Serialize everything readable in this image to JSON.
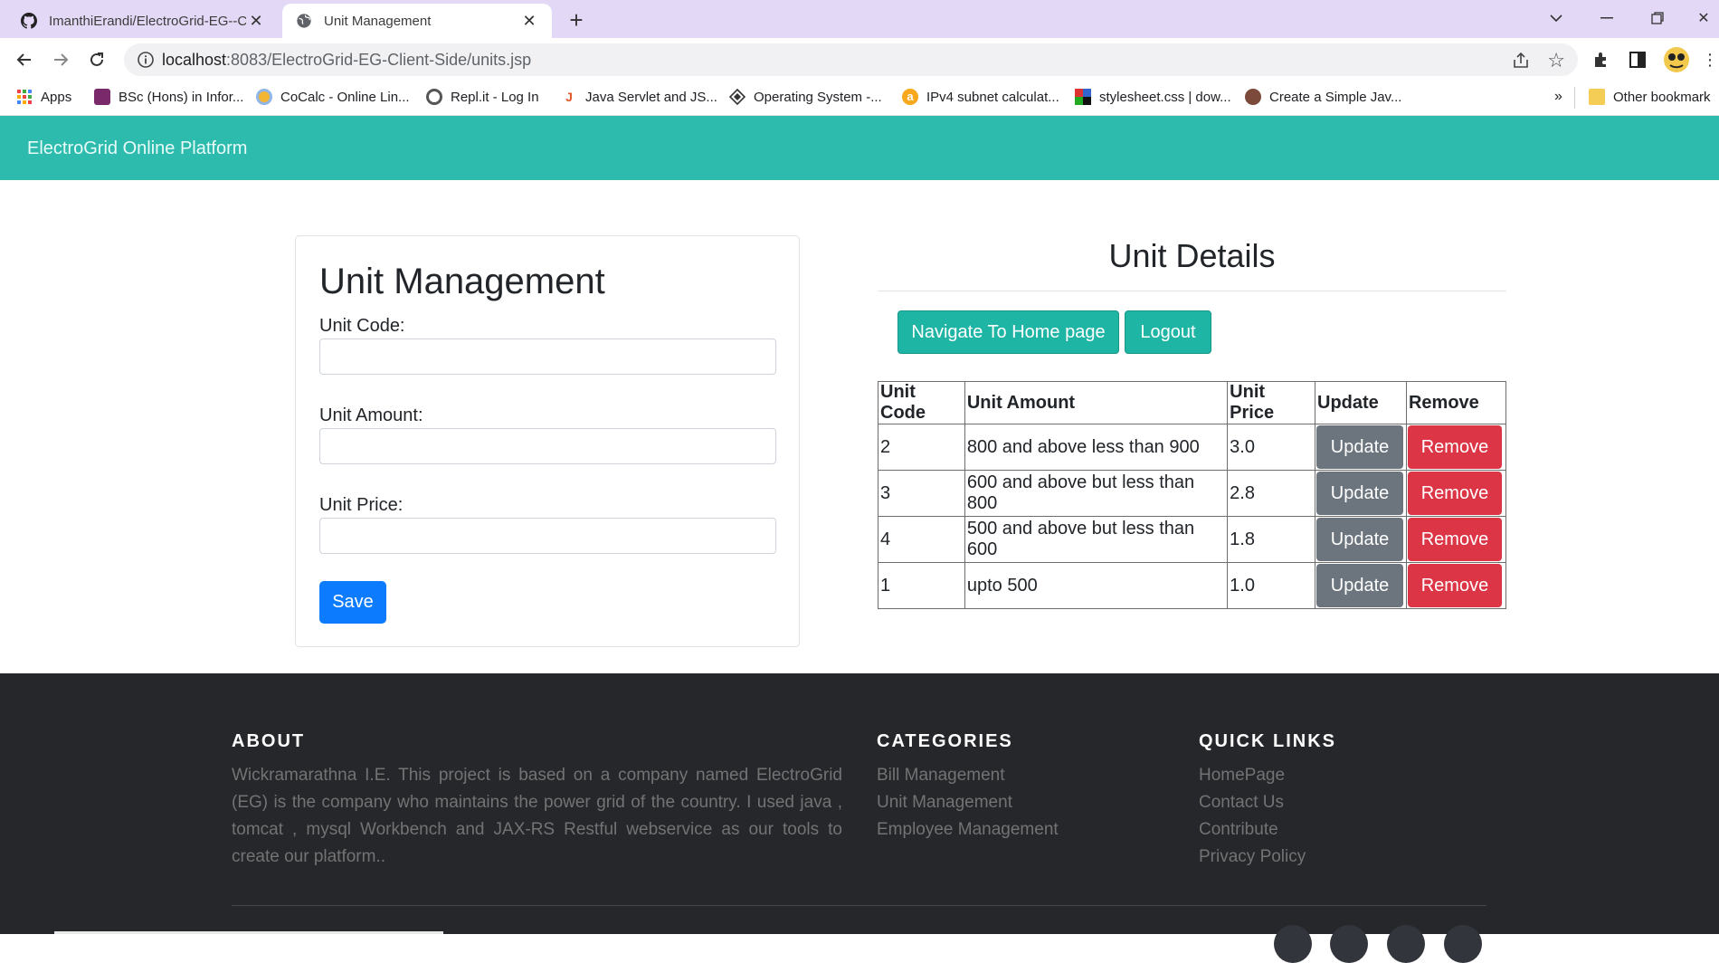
{
  "browser": {
    "tabs": [
      {
        "title": "ImanthiErandi/ElectroGrid-EG--Cl",
        "active": false
      },
      {
        "title": "Unit Management",
        "active": true
      }
    ],
    "address": {
      "host": "localhost",
      "path": ":8083/ElectroGrid-EG-Client-Side/units.jsp"
    },
    "bookmarks": [
      {
        "label": "Apps"
      },
      {
        "label": "BSc (Hons) in Infor..."
      },
      {
        "label": "CoCalc - Online Lin..."
      },
      {
        "label": "Repl.it - Log In"
      },
      {
        "label": "Java Servlet and JS..."
      },
      {
        "label": "Operating System -..."
      },
      {
        "label": "IPv4 subnet calculat..."
      },
      {
        "label": "stylesheet.css | dow..."
      },
      {
        "label": "Create a Simple Jav..."
      }
    ],
    "overflow": "»",
    "other_bookmarks": "Other bookmark"
  },
  "navbar": {
    "brand": "ElectroGrid Online Platform"
  },
  "form": {
    "title": "Unit Management",
    "unit_code_label": "Unit Code:",
    "unit_amount_label": "Unit Amount:",
    "unit_price_label": "Unit Price:",
    "save_label": "Save"
  },
  "details": {
    "title": "Unit Details",
    "home_button": "Navigate To Home page",
    "logout_button": "Logout",
    "columns": [
      "Unit Code",
      "Unit Amount",
      "Unit Price",
      "Update",
      "Remove"
    ],
    "rows": [
      {
        "code": "2",
        "amount": "800 and above less than 900",
        "price": "3.0",
        "update": "Update",
        "remove": "Remove"
      },
      {
        "code": "3",
        "amount": "600 and above but less than 800",
        "price": "2.8",
        "update": "Update",
        "remove": "Remove"
      },
      {
        "code": "4",
        "amount": "500 and above but less than 600",
        "price": "1.8",
        "update": "Update",
        "remove": "Remove"
      },
      {
        "code": "1",
        "amount": "upto 500",
        "price": "1.0",
        "update": "Update",
        "remove": "Remove"
      }
    ]
  },
  "footer": {
    "about_heading": "ABOUT",
    "about_text": "Wickramarathna I.E. This project is based on a company named ElectroGrid (EG) is the company who maintains the power grid of the country. I used java , tomcat , mysql Workbench and JAX-RS Restful webservice as our tools to create our platform..",
    "categories_heading": "CATEGORIES",
    "categories": [
      "Bill Management",
      "Unit Management",
      "Employee Management"
    ],
    "quick_links_heading": "QUICK LINKS",
    "quick_links": [
      "HomePage",
      "Contact Us",
      "Contribute",
      "Privacy Policy"
    ]
  },
  "colors": {
    "navbar": "#2cbbad",
    "teal_button": "#1fb5a5",
    "save_button": "#0d7bfd",
    "update_button": "#6c757d",
    "remove_button": "#dc3545",
    "footer": "#26272b",
    "tabbar": "#e3d9f6"
  },
  "icons": {
    "github_tab": "github-icon",
    "globe_tab": "globe-icon",
    "back": "back-arrow-icon",
    "forward": "forward-arrow-icon",
    "reload": "reload-icon",
    "info": "info-icon",
    "share": "share-icon",
    "star": "star-icon",
    "extensions": "puzzle-icon",
    "sidepanel": "side-panel-icon",
    "profile": "avatar",
    "menu": "kebab-menu-icon"
  }
}
